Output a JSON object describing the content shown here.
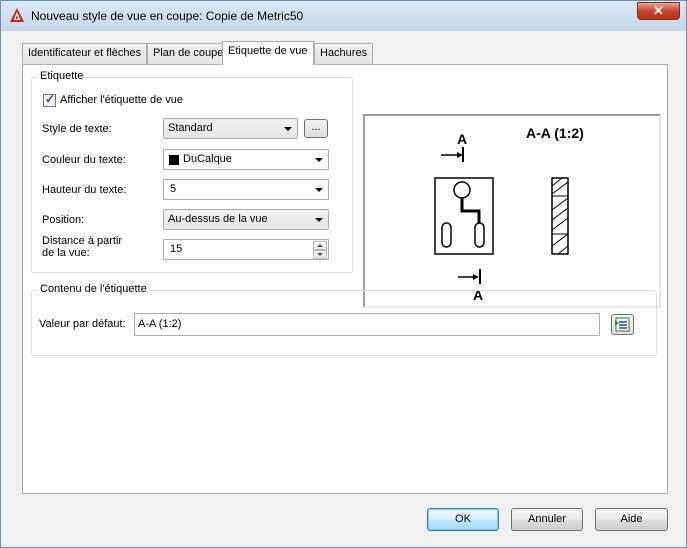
{
  "window": {
    "title": "Nouveau style de vue en coupe: Copie de Metric50"
  },
  "tabs": [
    {
      "label": "Identificateur et flèches"
    },
    {
      "label": "Plan de coupe"
    },
    {
      "label": "Etiquette de vue"
    },
    {
      "label": "Hachures"
    }
  ],
  "etiquette": {
    "group_title": "Etiquette",
    "show_label": "Afficher l'étiquette de vue",
    "show_label_checked": true,
    "text_style_label": "Style de texte:",
    "text_style_value": "Standard",
    "text_style_browse": "...",
    "text_color_label": "Couleur du texte:",
    "text_color_value": "DuCalque",
    "text_height_label": "Hauteur du texte:",
    "text_height_value": "5",
    "position_label": "Position:",
    "position_value": "Au-dessus de la vue",
    "distance_label_line1": "Distance à partir",
    "distance_label_line2": "de la vue:",
    "distance_value": "15"
  },
  "preview": {
    "marker_letter": "A",
    "view_label": "A-A (1:2)"
  },
  "contenu": {
    "group_title": "Contenu de l'étiquette",
    "default_value_label": "Valeur par défaut:",
    "default_value": "A-A (1:2)"
  },
  "footer": {
    "ok": "OK",
    "cancel": "Annuler",
    "help": "Aide"
  },
  "colors": {
    "accent": "#3c7fb1",
    "close": "#c7452c"
  }
}
